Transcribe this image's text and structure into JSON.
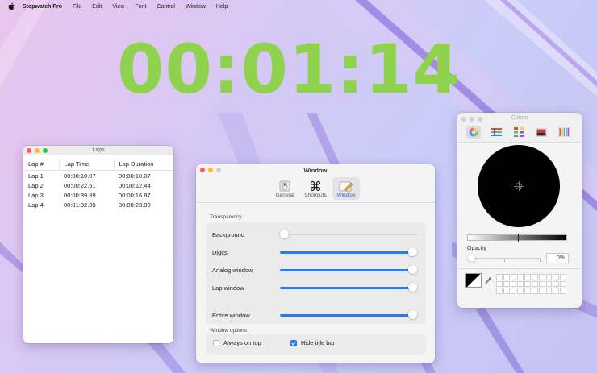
{
  "menubar": {
    "app_name": "Stopwatch Pro",
    "items": [
      "File",
      "Edit",
      "View",
      "Font",
      "Control",
      "Window",
      "Help"
    ]
  },
  "clock": {
    "time": "00:01:14",
    "color": "#8fd24e"
  },
  "laps_window": {
    "title": "Laps",
    "columns": [
      "Lap #",
      "Lap Time",
      "Lap Duration"
    ],
    "rows": [
      [
        "Lap 1",
        "00:00:10.07",
        "00:00:10.07"
      ],
      [
        "Lap 2",
        "00:00:22.51",
        "00:00:12.44"
      ],
      [
        "Lap 3",
        "00:00:39.39",
        "00:00:16.87"
      ],
      [
        "Lap 4",
        "00:01:02.39",
        "00:00:23.00"
      ]
    ]
  },
  "prefs_window": {
    "title": "Window",
    "tabs": [
      {
        "label": "General",
        "icon": "switch-icon"
      },
      {
        "label": "Shortcuts",
        "icon": "command-icon"
      },
      {
        "label": "Window",
        "icon": "window-pencil-icon",
        "active": true
      }
    ],
    "transparency": {
      "label": "Transparency",
      "rows": [
        {
          "label": "Background",
          "value": 0.0
        },
        {
          "label": "Digits",
          "value": 1.0
        },
        {
          "label": "Analog window",
          "value": 1.0
        },
        {
          "label": "Lap window",
          "value": 1.0
        },
        {
          "label": "Entire window",
          "value": 1.0
        }
      ]
    },
    "window_options": {
      "label": "Window options",
      "always_on_top": {
        "label": "Always on top",
        "checked": false
      },
      "hide_title_bar": {
        "label": "Hide title bar",
        "checked": true
      }
    },
    "accent": "#2b7bf0"
  },
  "colors_window": {
    "title": "Colors",
    "tabs": [
      "color-wheel-icon",
      "color-sliders-icon",
      "color-palettes-icon",
      "image-palettes-icon",
      "pencils-icon"
    ],
    "opacity": {
      "label": "Opacity",
      "value": "0%"
    },
    "selected_color": "#000000"
  }
}
